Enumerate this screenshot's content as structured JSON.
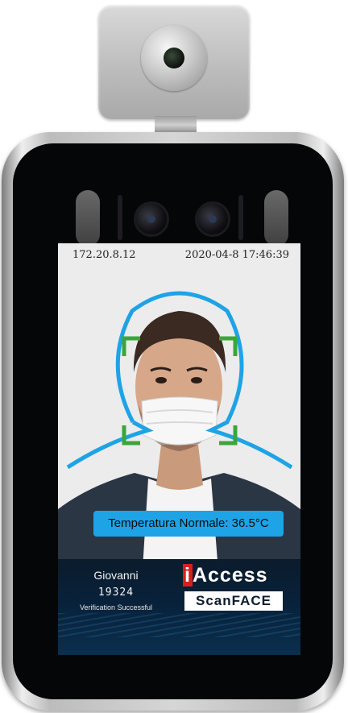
{
  "status_bar": {
    "ip_address": "172.20.8.12",
    "datetime": "2020-04-8 17:46:39"
  },
  "temperature_banner": {
    "text": "Temperatura Normale: 36.5°C"
  },
  "recognition": {
    "name": "Giovanni",
    "id": "19324",
    "status": "Verification Successful"
  },
  "brand": {
    "first_letter": "i",
    "name_rest": "Access",
    "product": "ScanFACE"
  },
  "colors": {
    "accent_blue": "#1ea3e6",
    "face_box_green": "#3aa63a",
    "brand_red": "#d81e1e"
  }
}
